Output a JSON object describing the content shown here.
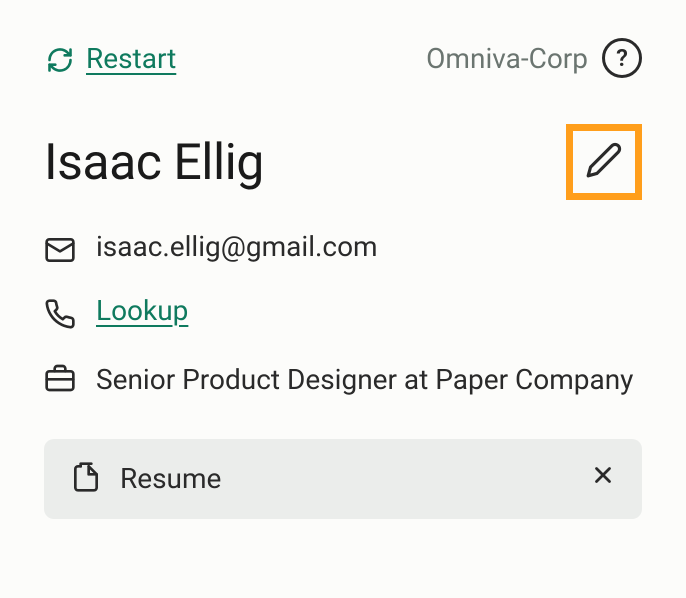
{
  "header": {
    "restart_label": "Restart",
    "org_name": "Omniva-Corp",
    "help_symbol": "?"
  },
  "candidate": {
    "name": "Isaac Ellig",
    "email": "isaac.ellig@gmail.com",
    "phone_lookup_label": "Lookup",
    "job_title": "Senior Product Designer at Paper Company"
  },
  "attachment": {
    "label": "Resume"
  }
}
